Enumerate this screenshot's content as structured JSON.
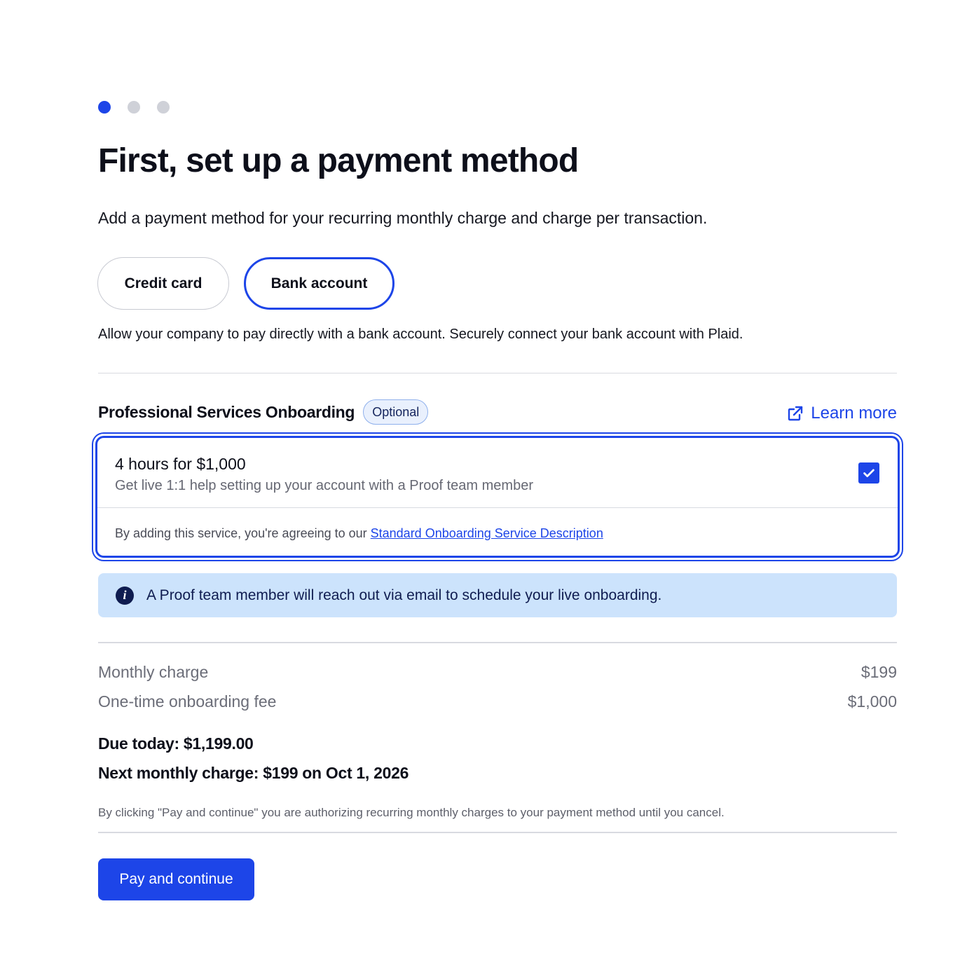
{
  "steps": {
    "total": 3,
    "current": 1
  },
  "header": {
    "title": "First, set up a payment method",
    "subtitle": "Add a payment method for your recurring monthly charge and charge per transaction."
  },
  "payment_methods": {
    "credit_card_label": "Credit card",
    "bank_account_label": "Bank account",
    "selected": "Bank account",
    "description": "Allow your company to pay directly with a bank account. Securely connect your bank account with Plaid."
  },
  "service": {
    "title": "Professional Services Onboarding",
    "badge": "Optional",
    "learn_more": "Learn more",
    "option_name": "4 hours for $1,000",
    "option_description": "Get live 1:1 help setting up your account with a Proof team member",
    "checked": true,
    "terms_prefix": "By adding this service, you're agreeing to our ",
    "terms_link": "Standard Onboarding Service Description"
  },
  "info_banner": {
    "text": "A Proof team member will reach out via email to schedule your live onboarding."
  },
  "summary": {
    "monthly_label": "Monthly charge",
    "monthly_value": "$199",
    "onboarding_label": "One-time onboarding fee",
    "onboarding_value": "$1,000",
    "due_today": "Due today: $1,199.00",
    "next_charge": "Next monthly charge: $199 on Oct 1, 2026"
  },
  "authorization_text": "By clicking \"Pay and continue\" you are authorizing recurring monthly charges to your payment method until you cancel.",
  "actions": {
    "pay_label": "Pay and continue"
  },
  "colors": {
    "accent": "#1d45e8",
    "info_bg": "#cce3fc",
    "info_text": "#0f1c50"
  }
}
